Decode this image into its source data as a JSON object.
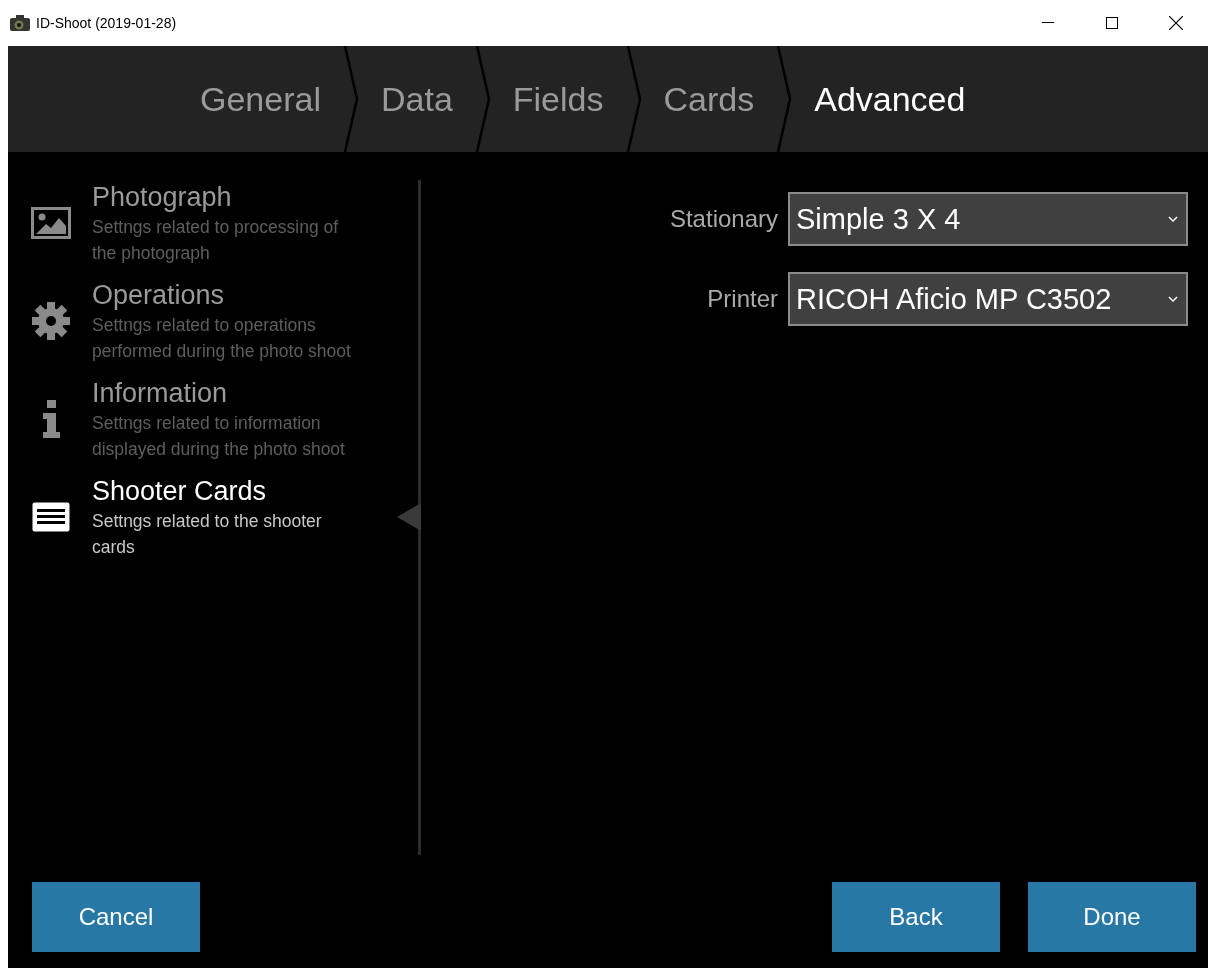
{
  "window": {
    "title": "ID-Shoot (2019-01-28)"
  },
  "tabs": [
    {
      "label": "General",
      "selected": false
    },
    {
      "label": "Data",
      "selected": false
    },
    {
      "label": "Fields",
      "selected": false
    },
    {
      "label": "Cards",
      "selected": false
    },
    {
      "label": "Advanced",
      "selected": true
    }
  ],
  "sidebar": {
    "items": [
      {
        "kind": "photo",
        "title": "Photograph",
        "description": "Settngs related to processing of the photograph",
        "selected": false
      },
      {
        "kind": "gear",
        "title": "Operations",
        "description": "Settngs related to operations performed during the photo shoot",
        "selected": false
      },
      {
        "kind": "info",
        "title": "Information",
        "description": "Settngs related to information displayed during the photo shoot",
        "selected": false
      },
      {
        "kind": "list",
        "title": "Shooter Cards",
        "description": "Settngs related to the shooter cards",
        "selected": true
      }
    ]
  },
  "form": {
    "fields": [
      {
        "label": "Stationary",
        "value": "Simple 3 X 4"
      },
      {
        "label": "Printer",
        "value": "RICOH Aficio MP C3502"
      }
    ]
  },
  "buttons": {
    "left": [
      "Cancel"
    ],
    "right": [
      "Back",
      "Done"
    ]
  }
}
